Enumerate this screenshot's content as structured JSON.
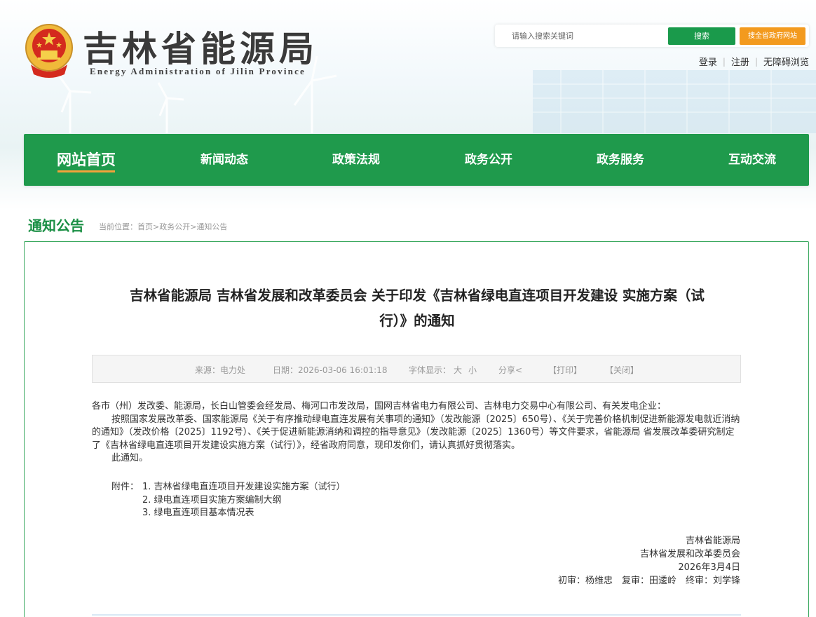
{
  "header": {
    "title": "吉林省能源局",
    "subtitle": "Energy Administration of Jilin Province",
    "search_placeholder": "请输入搜索关键词",
    "search_button": "搜索",
    "search_all_button": "搜全省政府网站",
    "links": [
      "登录",
      "注册",
      "无障碍浏览"
    ]
  },
  "nav": {
    "items": [
      "网站首页",
      "新闻动态",
      "政策法规",
      "政务公开",
      "政务服务",
      "互动交流"
    ],
    "active_index": 0
  },
  "section": {
    "title": "通知公告",
    "breadcrumb": "当前位置：首页>政务公开>通知公告"
  },
  "article": {
    "title_line1": "吉林省能源局 吉林省发展和改革委员会 关于印发《吉林省绿电直连项目开发建设 实施方案（试",
    "title_line2": "行）》的通知",
    "meta": {
      "source": "来源：电力处",
      "date": "日期：2026-03-06 16:01:18",
      "font_label": "字体显示：",
      "font_large": "大",
      "font_small": "小",
      "share": "分享",
      "print": "【打印】",
      "close": "【关闭】"
    },
    "addressee": "各市（州）发改委、能源局，长白山管委会经发局、梅河口市发改局，国网吉林省电力有限公司、吉林电力交易中心有限公司、有关发电企业：",
    "para1": "按照国家发展改革委、国家能源局《关于有序推动绿电直连发展有关事项的通知》（发改能源〔2025〕650号）、《关于完善价格机制促进新能源发电就近消纳的通知》（发改价格〔2025〕1192号）、《关于促进新能源消纳和调控的指导意见》（发改能源〔2025〕1360号）等文件要求，省能源局 省发展改革委研究制定了《吉林省绿电直连项目开发建设实施方案（试行）》，经省政府同意，现印发你们，请认真抓好贯彻落实。",
    "para2": "此通知。",
    "attachments_label": "附件：",
    "attachments": [
      "1. 吉林省绿电直连项目开发建设实施方案（试行）",
      "2. 绿电直连项目实施方案编制大纲",
      "3. 绿电直连项目基本情况表"
    ],
    "signature": {
      "org1": "吉林省能源局",
      "org2": "吉林省发展和改革委员会",
      "date": "2026年3月4日",
      "reviewers": "初审：杨维忠　复审：田逶岭　终审：刘学锋"
    }
  },
  "colors": {
    "primary_green": "#1f9a4c",
    "accent_orange": "#f39a1e",
    "title_green": "#1a8f44"
  }
}
